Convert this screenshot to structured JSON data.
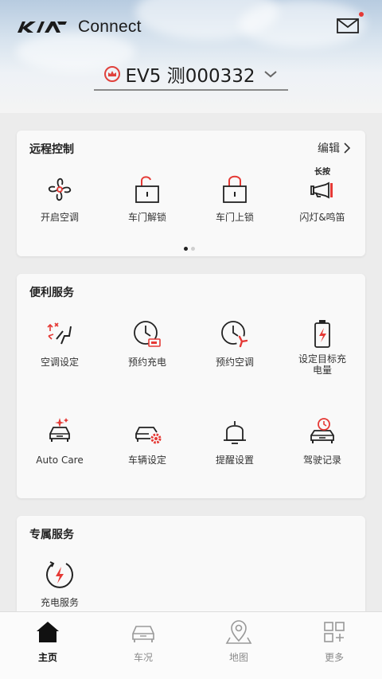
{
  "header": {
    "brand": "Connect",
    "brand_logo_icon": "kia-logo",
    "mail_icon": "mail-icon",
    "has_unread": true,
    "vehicle_name": "EV5 测000332"
  },
  "remote_control": {
    "title": "远程控制",
    "edit_label": "编辑",
    "long_press_hint": "长按",
    "items": [
      {
        "label": "开启空调",
        "icon": "fan-icon"
      },
      {
        "label": "车门解锁",
        "icon": "unlock-icon"
      },
      {
        "label": "车门上锁",
        "icon": "lock-icon"
      },
      {
        "label": "闪灯&鸣笛",
        "icon": "horn-icon"
      }
    ],
    "page_count": 2,
    "active_page": 1
  },
  "convenience": {
    "title": "便利服务",
    "items": [
      {
        "label": "空调设定",
        "icon": "climate-seat-icon"
      },
      {
        "label": "预约充电",
        "icon": "scheduled-charge-icon"
      },
      {
        "label": "预约空调",
        "icon": "scheduled-climate-icon"
      },
      {
        "label": "设定目标充电量",
        "icon": "battery-target-icon"
      },
      {
        "label": "Auto Care",
        "icon": "auto-care-icon"
      },
      {
        "label": "车辆设定",
        "icon": "car-settings-icon"
      },
      {
        "label": "提醒设置",
        "icon": "bell-icon"
      },
      {
        "label": "驾驶记录",
        "icon": "driving-record-icon"
      }
    ]
  },
  "exclusive": {
    "title": "专属服务",
    "items": [
      {
        "label": "充电服务",
        "icon": "charging-service-icon"
      }
    ]
  },
  "tabbar": {
    "items": [
      {
        "label": "主页",
        "icon": "home-icon",
        "active": true
      },
      {
        "label": "车况",
        "icon": "car-status-icon",
        "active": false
      },
      {
        "label": "地图",
        "icon": "map-icon",
        "active": false
      },
      {
        "label": "更多",
        "icon": "more-icon",
        "active": false
      }
    ]
  },
  "colors": {
    "accent_red": "#e53935",
    "text_dark": "#222222",
    "card_bg": "#f9f9f9",
    "page_bg": "#ececec"
  }
}
